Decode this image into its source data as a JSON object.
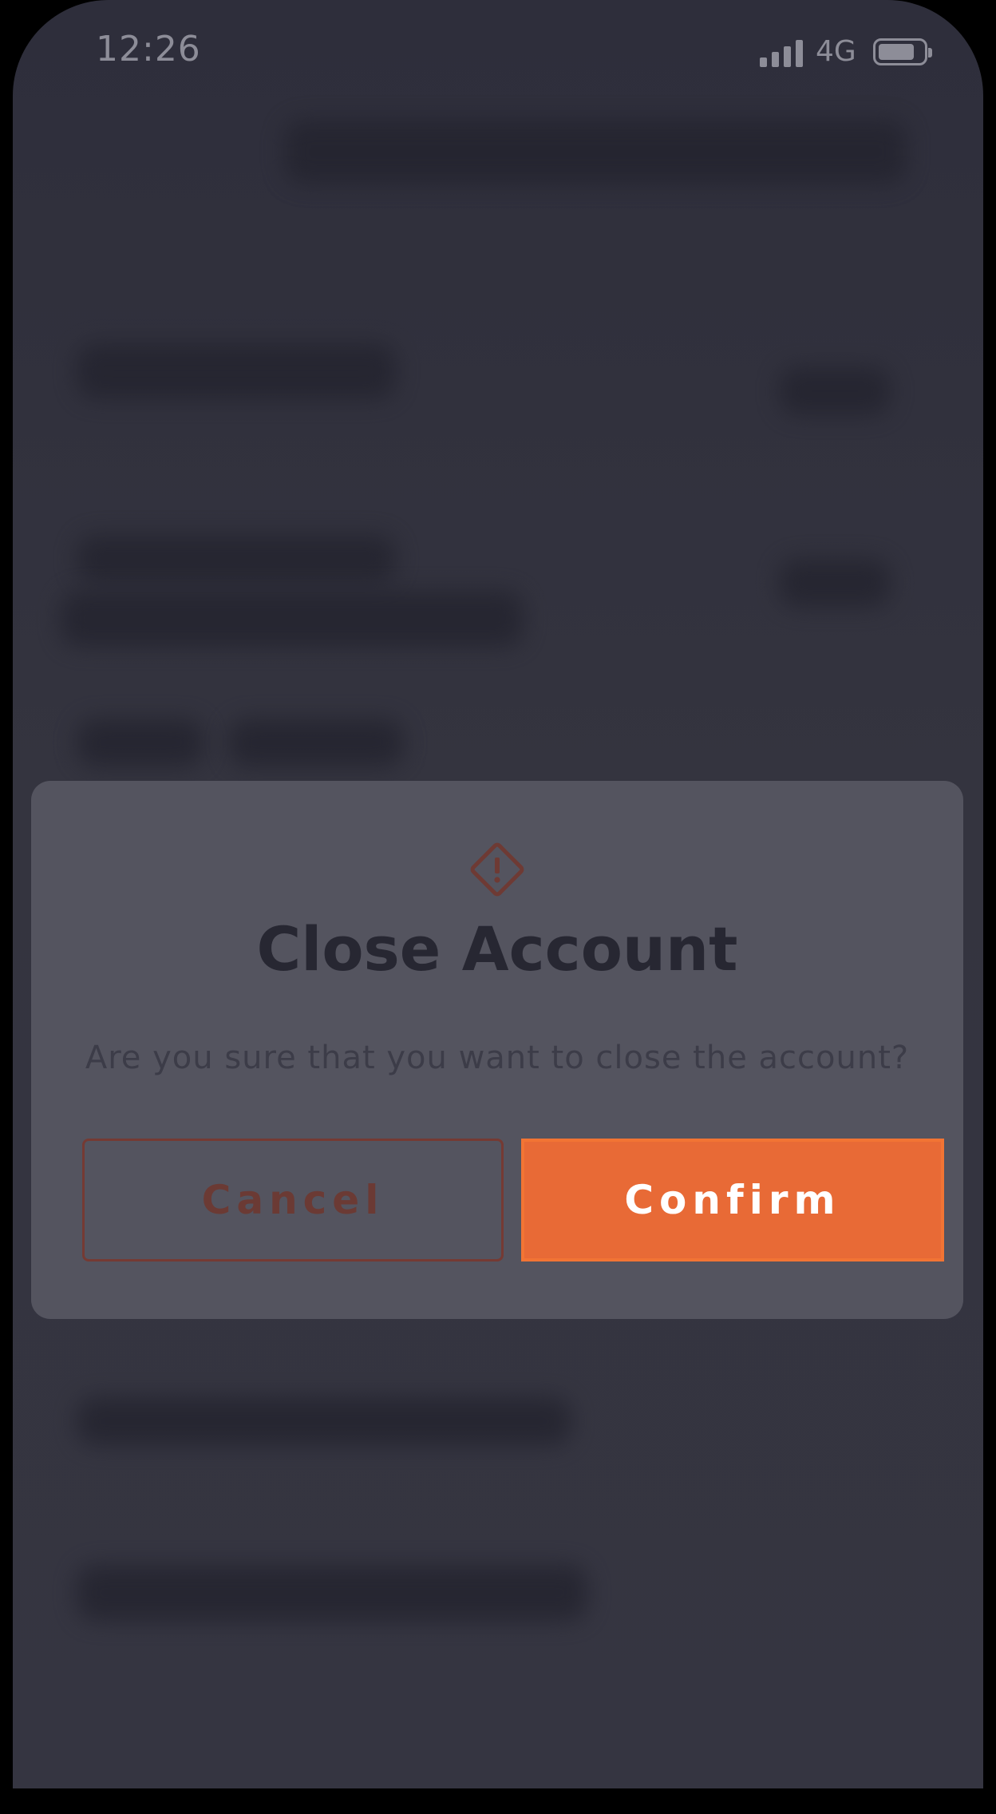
{
  "status_bar": {
    "time": "12:26",
    "network": "4G"
  },
  "dialog": {
    "icon": "warning-diamond-icon",
    "title": "Close Account",
    "message": "Are you sure that you want to close the account?",
    "cancel_label": "Cancel",
    "confirm_label": "Confirm"
  },
  "colors": {
    "accent": "#e86a36",
    "modal_bg": "#54545f",
    "screen_bg": "#353541"
  }
}
